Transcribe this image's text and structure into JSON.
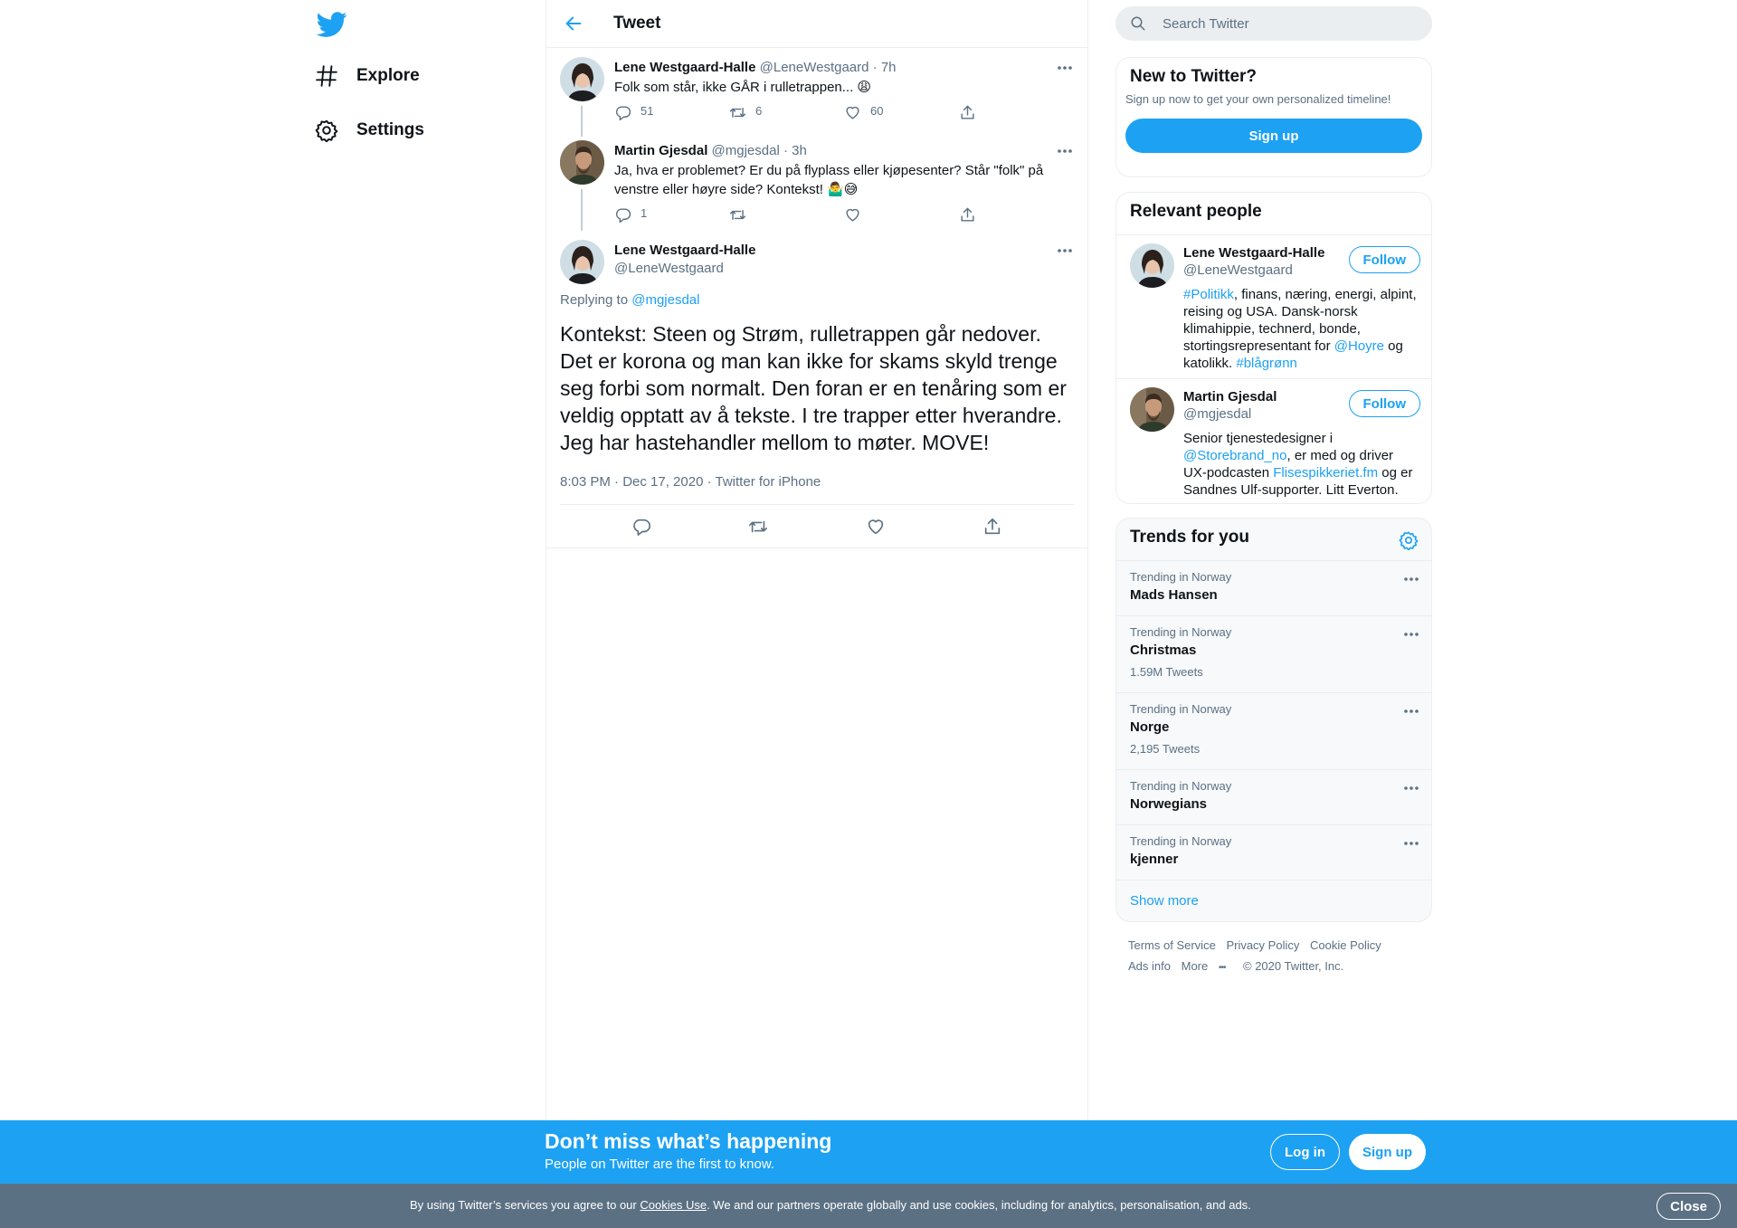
{
  "nav": {
    "explore": "Explore",
    "settings": "Settings"
  },
  "header": {
    "title": "Tweet"
  },
  "search": {
    "placeholder": "Search Twitter"
  },
  "thread": [
    {
      "name": "Lene Westgaard-Halle",
      "handle": "@LeneWestgaard",
      "time": "· 7h",
      "text": "Folk som står, ikke GÅR i rulletrappen... 😩",
      "replies": "51",
      "retweets": "6",
      "likes": "60"
    },
    {
      "name": "Martin Gjesdal",
      "handle": "@mgjesdal",
      "time": "· 3h",
      "text": "Ja, hva er problemet? Er du på flyplass eller kjøpesenter? Står \"folk\" på venstre eller høyre side? Kontekst! 🤷‍♂️😅",
      "replies": "1",
      "retweets": "",
      "likes": ""
    }
  ],
  "main_tweet": {
    "name": "Lene Westgaard-Halle",
    "handle": "@LeneWestgaard",
    "replying_prefix": "Replying to",
    "replying_to": "@mgjesdal",
    "text": "Kontekst: Steen og Strøm, rulletrappen går nedover. Det er korona og man kan ikke for skams skyld trenge seg forbi som normalt. Den foran er en tenåring som er veldig opptatt av å tekste. I tre trapper etter hverandre. Jeg har hastehandler mellom to møter. MOVE!",
    "timestamp": "8:03 PM · Dec 17, 2020",
    "source": "Twitter for iPhone"
  },
  "new_to_twitter": {
    "title": "New to Twitter?",
    "subtitle": "Sign up now to get your own personalized timeline!",
    "button": "Sign up"
  },
  "relevant_people": {
    "title": "Relevant people",
    "follow_label": "Follow",
    "people": [
      {
        "name": "Lene Westgaard-Halle",
        "handle": "@LeneWestgaard",
        "bio_1": "#Politikk",
        "bio_2": ", finans, næring, energi, alpint, reising og USA. Dansk-norsk klimahippie, technerd, bonde, stortingsrepresentant for ",
        "bio_3": "@Hoyre",
        "bio_4": " og katolikk. ",
        "bio_5": "#blågrønn"
      },
      {
        "name": "Martin Gjesdal",
        "handle": "@mgjesdal",
        "bio_1": "Senior tjenestedesigner i ",
        "bio_2": "@Storebrand_no",
        "bio_3": ", er med og driver UX-podcasten ",
        "bio_4": "Flisespikkeriet.fm",
        "bio_5": " og er Sandnes Ulf-supporter. Litt Everton."
      }
    ]
  },
  "trends": {
    "title": "Trends for you",
    "items": [
      {
        "context": "Trending in Norway",
        "name": "Mads Hansen",
        "count": ""
      },
      {
        "context": "Trending in Norway",
        "name": "Christmas",
        "count": "1.59M Tweets"
      },
      {
        "context": "Trending in Norway",
        "name": "Norge",
        "count": "2,195 Tweets"
      },
      {
        "context": "Trending in Norway",
        "name": "Norwegians",
        "count": ""
      },
      {
        "context": "Trending in Norway",
        "name": "kjenner",
        "count": ""
      }
    ],
    "show_more": "Show more"
  },
  "footer": {
    "terms": "Terms of Service",
    "privacy": "Privacy Policy",
    "cookie": "Cookie Policy",
    "ads": "Ads info",
    "more": "More",
    "copyright": "© 2020 Twitter, Inc."
  },
  "banner": {
    "headline": "Don’t miss what’s happening",
    "sub": "People on Twitter are the first to know.",
    "login": "Log in",
    "signup": "Sign up"
  },
  "cookie_bar": {
    "text_1": "By using Twitter’s services you agree to our ",
    "link": "Cookies Use",
    "text_2": ". We and our partners operate globally and use cookies, including for analytics, personalisation, and ads.",
    "close": "Close"
  },
  "colors": {
    "accent": "#1da1f2",
    "secondary_text": "#5b7083",
    "cookie_bg": "#5b7083"
  }
}
